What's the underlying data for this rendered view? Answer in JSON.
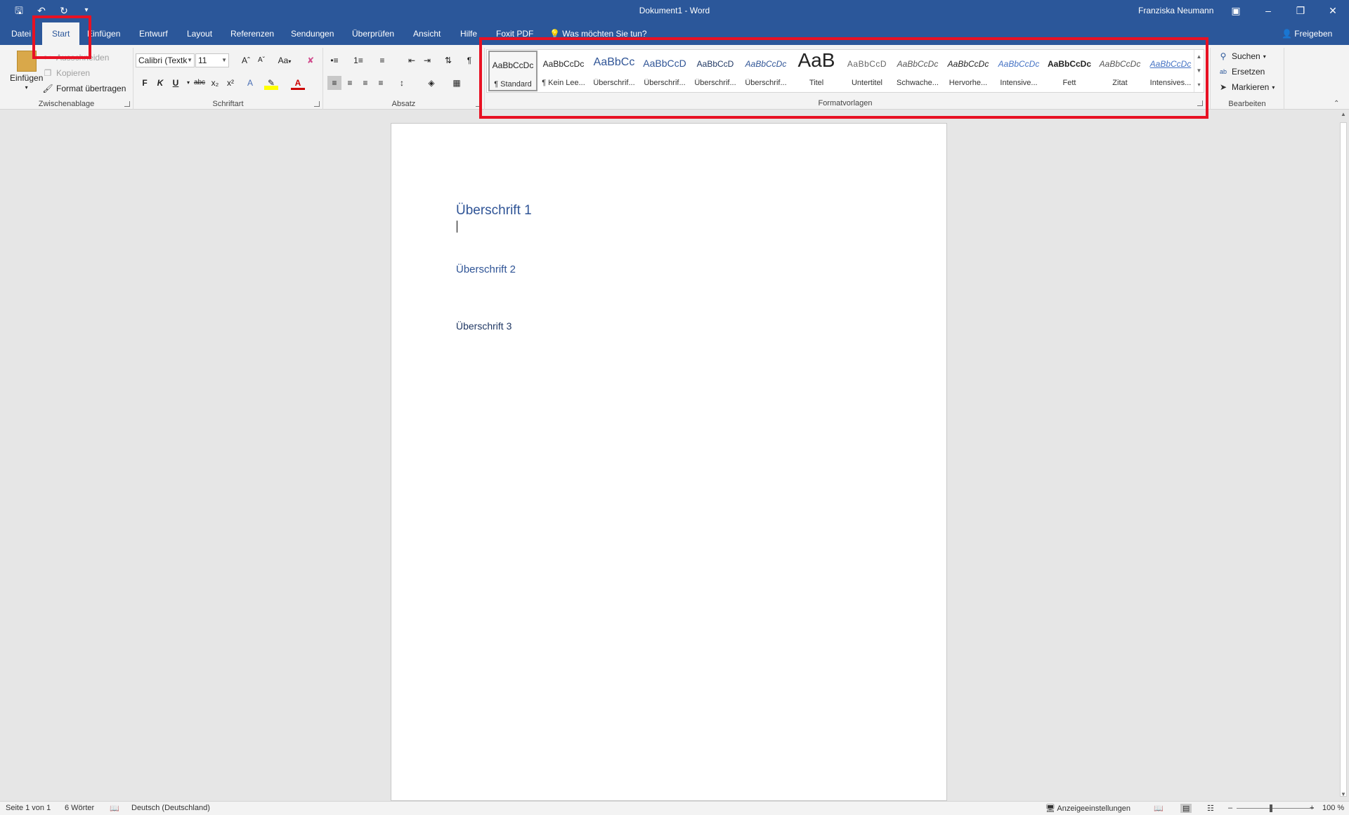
{
  "titlebar": {
    "document_title": "Dokument1  -  Word",
    "user_name": "Franziska Neumann",
    "qat_icons": [
      "save-icon",
      "undo-icon",
      "redo-icon",
      "customize-qat-icon"
    ]
  },
  "tabs": [
    {
      "label": "Datei"
    },
    {
      "label": "Start"
    },
    {
      "label": "Einfügen"
    },
    {
      "label": "Entwurf"
    },
    {
      "label": "Layout"
    },
    {
      "label": "Referenzen"
    },
    {
      "label": "Sendungen"
    },
    {
      "label": "Überprüfen"
    },
    {
      "label": "Ansicht"
    },
    {
      "label": "Hilfe"
    },
    {
      "label": "Foxit PDF"
    }
  ],
  "tell_me": "Was möchten Sie tun?",
  "share": "Freigeben",
  "clipboard": {
    "paste": "Einfügen",
    "cut": "Ausschneiden",
    "copy": "Kopieren",
    "format_painter": "Format übertragen",
    "group_label": "Zwischenablage"
  },
  "font": {
    "font_name": "Calibri (Textk",
    "font_size": "11",
    "bold": "F",
    "italic": "K",
    "underline": "U",
    "strikethrough": "abc",
    "subscript": "x₂",
    "superscript": "x²",
    "change_case": "Aa",
    "group_label": "Schriftart"
  },
  "paragraph": {
    "group_label": "Absatz"
  },
  "styles": {
    "items": [
      {
        "sample": "AaBbCcDc",
        "name": "¶ Standard"
      },
      {
        "sample": "AaBbCcDc",
        "name": "¶ Kein Lee..."
      },
      {
        "sample": "AaBbCc",
        "name": "Überschrif..."
      },
      {
        "sample": "AaBbCcD",
        "name": "Überschrif..."
      },
      {
        "sample": "AaBbCcD",
        "name": "Überschrif..."
      },
      {
        "sample": "AaBbCcDc",
        "name": "Überschrif..."
      },
      {
        "sample": "AaB",
        "name": "Titel"
      },
      {
        "sample": "AaBbCcD",
        "name": "Untertitel"
      },
      {
        "sample": "AaBbCcDc",
        "name": "Schwache..."
      },
      {
        "sample": "AaBbCcDc",
        "name": "Hervorhe..."
      },
      {
        "sample": "AaBbCcDc",
        "name": "Intensive..."
      },
      {
        "sample": "AaBbCcDc",
        "name": "Fett"
      },
      {
        "sample": "AaBbCcDc",
        "name": "Zitat"
      },
      {
        "sample": "AaBbCcDc",
        "name": "Intensives..."
      }
    ],
    "group_label": "Formatvorlagen"
  },
  "editing": {
    "find": "Suchen",
    "replace": "Ersetzen",
    "select": "Markieren",
    "group_label": "Bearbeiten"
  },
  "document": {
    "heading1": "Überschrift 1",
    "heading2": "Überschrift 2",
    "heading3": "Überschrift 3"
  },
  "statusbar": {
    "page": "Seite 1 von 1",
    "words": "6 Wörter",
    "language": "Deutsch (Deutschland)",
    "display_settings": "Anzeigeeinstellungen",
    "zoom": "100 %"
  },
  "colors": {
    "accent": "#2b579a",
    "heading": "#2f5496",
    "highlight_box": "#e81123"
  }
}
